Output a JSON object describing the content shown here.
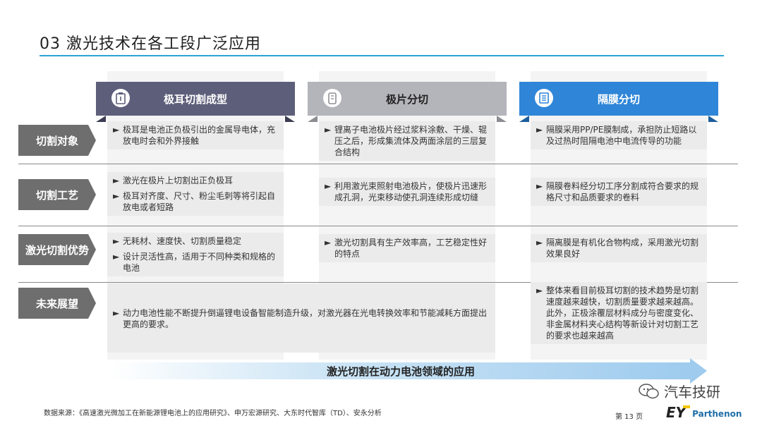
{
  "title": "03 激光技术在各工段广泛应用",
  "columns": [
    {
      "label": "极耳切割成型",
      "icon": "tab-cutting-icon",
      "color": "#5d5f7a"
    },
    {
      "label": "极片分切",
      "icon": "electrode-slitting-icon",
      "color": "#b4b4bb"
    },
    {
      "label": "隔膜分切",
      "icon": "separator-slitting-icon",
      "color": "#2f86d8"
    }
  ],
  "rows": [
    {
      "label": "切割对象",
      "cells": [
        [
          "极耳是电池正负极引出的金属导电体，充放电时会和外界接触"
        ],
        [
          "锂离子电池极片经过浆料涂敷、干燥、辊压之后，形成集流体及两面涂层的三层复合结构"
        ],
        [
          "隔膜采用PP/PE膜制成，承担防止短路以及过热时阻隔电池中电流传导的功能"
        ]
      ]
    },
    {
      "label": "切割工艺",
      "cells": [
        [
          "激光在极片上切割出正负极耳",
          "极耳对齐度、尺寸、粉尘毛刺等将引起自放电或者短路"
        ],
        [
          "利用激光束照射电池极片，使极片迅速形成孔洞，光束移动使孔洞连续形成切缝"
        ],
        [
          "隔膜卷料经分切工序分割成符合要求的规格尺寸和品质要求的卷料"
        ]
      ]
    },
    {
      "label": "激光切割优势",
      "cells": [
        [
          "无耗材、速度快、切割质量稳定",
          "设计灵活性高，适用于不同种类和规格的电池"
        ],
        [
          "激光切割具有生产效率高，工艺稳定性好的特点"
        ],
        [
          "隔离膜是有机化合物构成，采用激光切割效果良好"
        ]
      ]
    },
    {
      "label": "未来展望",
      "wide": "动力电池性能不断提升倒逼锂电设备智能制造升级，对激光器在光电转换效率和节能减耗方面提出更高的要求。",
      "right": "整体来看目前极耳切割的技术趋势是切割速度越来越快，切割质量要求越来越高。此外，正极涂覆层材料成分与密度变化、非金属材料夹心结构等新设计对切割工艺的要求也越来越高"
    }
  ],
  "arrow_label": "激光切割在动力电池领域的应用",
  "source": "数据来源：《高速激光微加工在新能源锂电池上的应用研究》、申万宏源研究、大东时代智库（TD）、安永分析",
  "page": "第 13 页",
  "brand": {
    "ey": "EY",
    "name": "Parthenon"
  },
  "watermark": "汽车技研",
  "colors": {
    "accent": "#2ba3d8",
    "row_label": "#6e6e6e"
  }
}
